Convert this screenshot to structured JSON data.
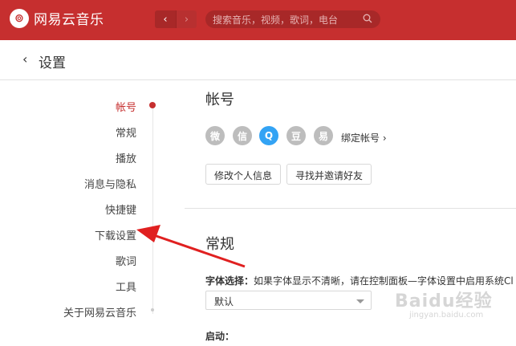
{
  "app": {
    "name": "网易云音乐",
    "logo_glyph": "⊚"
  },
  "nav": {
    "back_glyph": "‹",
    "forward_glyph": "›"
  },
  "search": {
    "placeholder": "搜索音乐，视频，歌词，电台"
  },
  "header": {
    "back_glyph": "‹",
    "title": "设置"
  },
  "sidebar": {
    "items": [
      {
        "label": "帐号",
        "active": true
      },
      {
        "label": "常规",
        "active": false
      },
      {
        "label": "播放",
        "active": false
      },
      {
        "label": "消息与隐私",
        "active": false
      },
      {
        "label": "快捷键",
        "active": false
      },
      {
        "label": "下载设置",
        "active": false
      },
      {
        "label": "歌词",
        "active": false
      },
      {
        "label": "工具",
        "active": false
      },
      {
        "label": "关于网易云音乐",
        "active": false
      }
    ]
  },
  "account": {
    "title": "帐号",
    "icons": [
      {
        "name": "weibo-icon",
        "glyph": "微"
      },
      {
        "name": "wechat-icon",
        "glyph": "信"
      },
      {
        "name": "qq-icon",
        "glyph": "Q"
      },
      {
        "name": "douban-icon",
        "glyph": "豆"
      },
      {
        "name": "yixin-icon",
        "glyph": "易"
      }
    ],
    "bind_label": "绑定帐号",
    "bind_arrow": "›",
    "edit_profile_button": "修改个人信息",
    "invite_friends_button": "寻找并邀请好友"
  },
  "general": {
    "title": "常规",
    "font_label": "字体选择：",
    "font_hint": "如果字体显示不清晰，请在控制面板—字体设置中启用系统Cl",
    "font_value": "默认",
    "startup_label": "启动："
  },
  "watermark": {
    "main": "Baidu经验",
    "sub": "jingyan.baidu.com"
  },
  "colors": {
    "brand": "#c62f2f",
    "qq": "#33a3f4"
  }
}
